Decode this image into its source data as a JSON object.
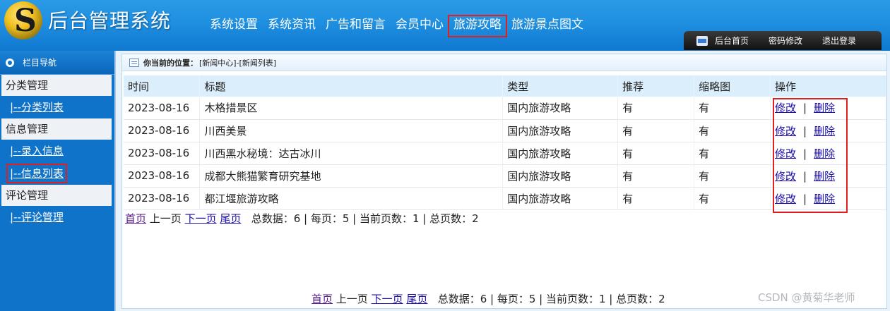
{
  "header": {
    "logo_letter": "S",
    "app_title": "后台管理系统",
    "nav": [
      "系统设置",
      "系统资讯",
      "广告和留言",
      "会员中心",
      "旅游攻略",
      "旅游景点图文"
    ],
    "toolbar": {
      "home": "后台首页",
      "password": "密码修改",
      "logout": "退出登录"
    }
  },
  "sidebar": {
    "title": "栏目导航",
    "groups": [
      {
        "label": "分类管理",
        "items": [
          "|--分类列表"
        ]
      },
      {
        "label": "信息管理",
        "items": [
          "|--录入信息",
          "|--信息列表"
        ]
      },
      {
        "label": "评论管理",
        "items": [
          "|--评论管理"
        ]
      }
    ]
  },
  "location": {
    "label": "你当前的位置：",
    "path": "[新闻中心]-[新闻列表]"
  },
  "table": {
    "headers": [
      "时间",
      "标题",
      "类型",
      "推荐",
      "缩略图",
      "操作"
    ],
    "rows": [
      {
        "time": "2023-08-16",
        "title": "木格措景区",
        "type": "国内旅游攻略",
        "recommend": "有",
        "thumb": "有"
      },
      {
        "time": "2023-08-16",
        "title": "川西美景",
        "type": "国内旅游攻略",
        "recommend": "有",
        "thumb": "有"
      },
      {
        "time": "2023-08-16",
        "title": "川西黑水秘境：达古冰川",
        "type": "国内旅游攻略",
        "recommend": "有",
        "thumb": "有"
      },
      {
        "time": "2023-08-16",
        "title": "成都大熊猫繁育研究基地",
        "type": "国内旅游攻略",
        "recommend": "有",
        "thumb": "有"
      },
      {
        "time": "2023-08-16",
        "title": "都江堰旅游攻略",
        "type": "国内旅游攻略",
        "recommend": "有",
        "thumb": "有"
      }
    ],
    "edit_label": "修改",
    "separator": "|",
    "delete_label": "删除"
  },
  "pager": {
    "first": "首页",
    "prev": "上一页",
    "next": "下一页",
    "last": "尾页",
    "summary": "总数据：6 | 每页：5 | 当前页数：1 | 总页数：2"
  },
  "watermark": "CSDN @黄菊华老师",
  "colors": {
    "header": "#1f8fe0",
    "sidebar": "#0f73c9",
    "highlight": "#e02020",
    "link": "#1a0dab"
  }
}
